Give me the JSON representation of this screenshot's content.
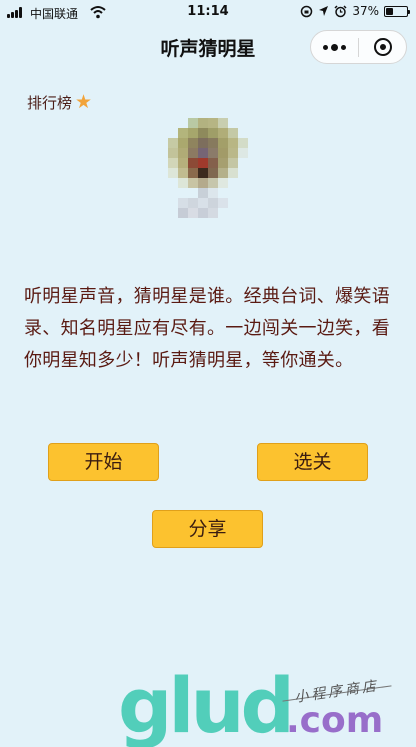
{
  "status_bar": {
    "carrier": "中国联通",
    "time": "11:14",
    "battery_percent": "37%",
    "battery_level": 0.37,
    "icons": [
      "signal-icon",
      "wifi-icon",
      "rotation-lock-icon",
      "location-icon",
      "alarm-icon",
      "battery-icon"
    ]
  },
  "nav": {
    "title": "听声猜明星",
    "capsule_icons": [
      "more-icon",
      "close-miniprogram-icon"
    ]
  },
  "ranking": {
    "label": "排行榜",
    "icon": "star-icon",
    "icon_color": "#f2a43a"
  },
  "avatar": {
    "icon": "star-avatar-pixelated",
    "pixels": [
      "#e2f2f9",
      "#e2f2f9",
      "#b9c9a4",
      "#b2b280",
      "#b6b584",
      "#c8ceb0",
      "#e2f2f9",
      "#e2f2f9",
      "#e2f2f9",
      "#b3b57c",
      "#a6a66c",
      "#8e8a5c",
      "#9f9e68",
      "#b0ad78",
      "#c4c9a6",
      "#e2f2f9",
      "#c6caa4",
      "#aaa86e",
      "#8f845e",
      "#7d6e5d",
      "#877a5e",
      "#a39f69",
      "#b8b684",
      "#d3dcc8",
      "#c2c39a",
      "#b0ab76",
      "#8c7a62",
      "#766575",
      "#8b7b6a",
      "#a29b68",
      "#bab88a",
      "#dde8e4",
      "#d2d6b8",
      "#b6b07c",
      "#8c4a36",
      "#a03a2c",
      "#84604c",
      "#a69f70",
      "#c4c6a4",
      "#e2f2f9",
      "#dde6d8",
      "#c1bc90",
      "#8a6a4c",
      "#3c2a1e",
      "#806850",
      "#b4b08a",
      "#d8e0d0",
      "#e2f2f9",
      "#e2f2f9",
      "#dde6d8",
      "#c8c4a4",
      "#b4aa8c",
      "#c6c6ac",
      "#dfe8e0",
      "#e2f2f9",
      "#e2f2f9",
      "#e2f2f9",
      "#e2f2f9",
      "#e2f2f9",
      "#c8d0d8",
      "#dce6ec",
      "#e2f2f9",
      "#e2f2f9",
      "#e2f2f9",
      "#e2f2f9",
      "#d6dee6",
      "#cfd6de",
      "#d8e0e8",
      "#cdd4dc",
      "#dae2ea",
      "#e2f2f9",
      "#e2f2f9",
      "#e2f2f9",
      "#c6ccd6",
      "#d8dce4",
      "#c8ced8",
      "#d4dae2",
      "#e2f2f9",
      "#e2f2f9",
      "#e2f2f9",
      "#e2f2f9",
      "#e2f2f9",
      "#e2f2f9",
      "#e2f2f9",
      "#e2f2f9",
      "#e2f2f9",
      "#e2f2f9",
      "#e2f2f9"
    ]
  },
  "description": "听明星声音，猜明星是谁。经典台词、爆笑语录、知名明星应有尽有。一边闯关一边笑，看你明星知多少！听声猜明星，等你通关。",
  "buttons": {
    "start": "开始",
    "select_level": "选关",
    "share": "分享"
  },
  "colors": {
    "background": "#e2f2f9",
    "button": "#fcc22f",
    "text": "#5a1a12"
  },
  "watermark": {
    "logo": "glud",
    "suffix": ".com",
    "subtitle": "小程序商店"
  }
}
